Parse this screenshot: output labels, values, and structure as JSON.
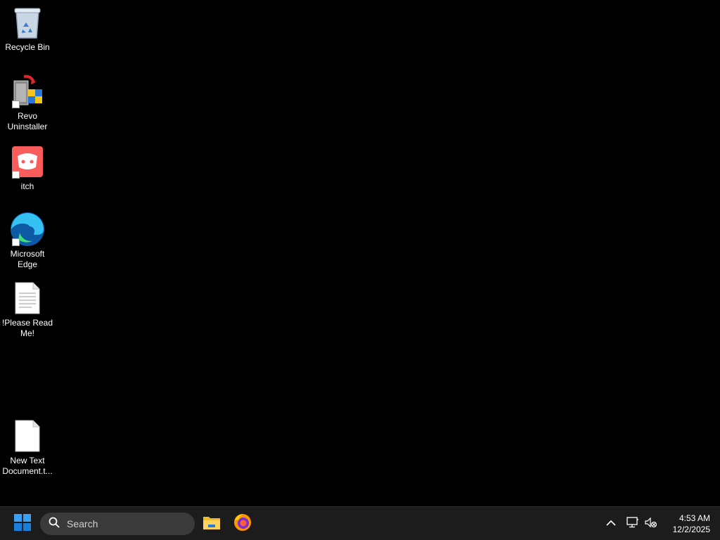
{
  "desktop": {
    "icons": [
      {
        "label": "Recycle Bin",
        "icon": "recycle-bin-icon",
        "shortcut": false
      },
      {
        "label": "Revo Uninstaller",
        "icon": "revo-uninstaller-icon",
        "shortcut": true
      },
      {
        "label": "itch",
        "icon": "itch-icon",
        "shortcut": true
      },
      {
        "label": "Microsoft Edge",
        "icon": "edge-icon",
        "shortcut": true
      },
      {
        "label": "!Please Read Me!",
        "icon": "text-document-icon",
        "shortcut": false
      },
      {
        "label": "New Text Document.t...",
        "icon": "blank-document-icon",
        "shortcut": false
      }
    ]
  },
  "taskbar": {
    "start_icon": "windows-start-icon",
    "search_placeholder": "Search",
    "pinned": [
      {
        "icon": "file-explorer-icon"
      },
      {
        "icon": "firefox-icon"
      }
    ],
    "tray": {
      "chevron_icon": "chevron-up-icon",
      "network_icon": "network-icon",
      "volume_icon": "volume-muted-icon"
    },
    "clock": {
      "time": "4:53 AM",
      "date": "12/2/2025"
    }
  },
  "colors": {
    "desktop_bg": "#000000",
    "taskbar_bg": "#1c1c1c",
    "search_bg": "#3a3a3a",
    "accent": "#0078d4"
  }
}
